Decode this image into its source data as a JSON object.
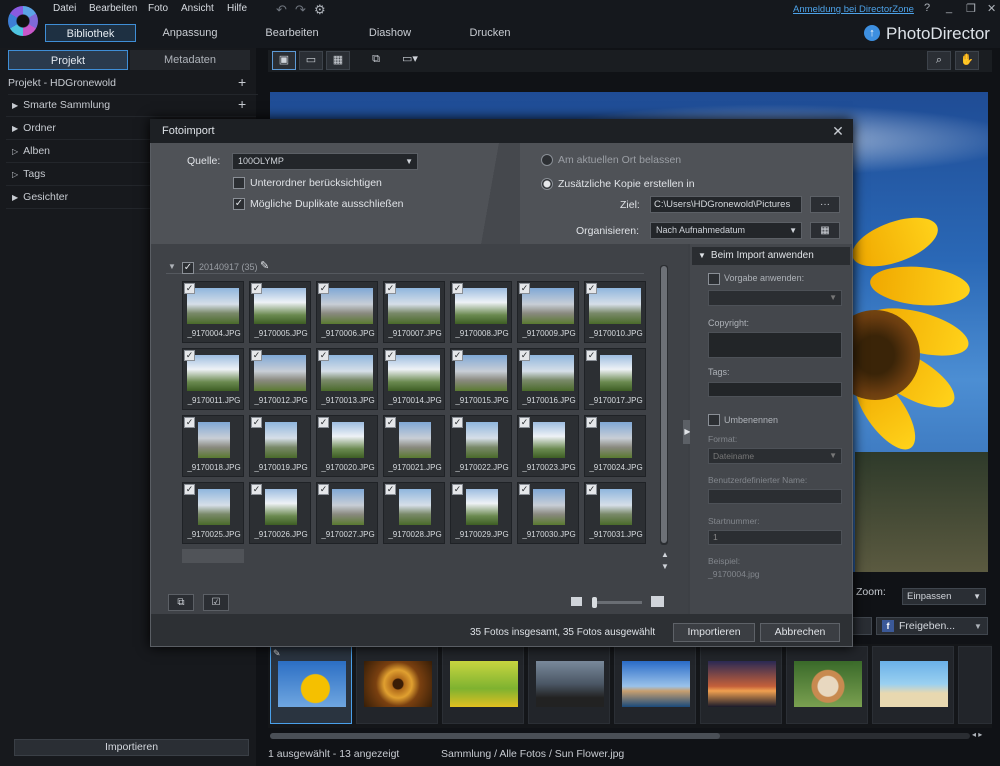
{
  "menu": [
    "Datei",
    "Bearbeiten",
    "Foto",
    "Ansicht",
    "Hilfe"
  ],
  "signin": "Anmeldung bei DirectorZone",
  "window_buttons": [
    "?",
    "_",
    "❐",
    "✕"
  ],
  "modes": [
    "Bibliothek",
    "Anpassung",
    "Bearbeiten",
    "Diashow",
    "Drucken"
  ],
  "brand": "PhotoDirector",
  "left": {
    "tabs": [
      "Projekt",
      "Metadaten"
    ],
    "project": "Projekt - HDGronewold",
    "items": [
      "Smarte Sammlung",
      "Ordner",
      "Alben",
      "Tags",
      "Gesichter"
    ],
    "import_button": "Importieren"
  },
  "view": {
    "zoom_label": "Zoom:",
    "zoom_value": "Einpassen",
    "share_label": "Freigeben..."
  },
  "status": {
    "left": "1 ausgewählt - 13 angezeigt",
    "path": "Sammlung / Alle Fotos / Sun Flower.jpg"
  },
  "dialog": {
    "title": "Fotoimport",
    "source_label": "Quelle:",
    "source_value": "100OLYMP",
    "subfolders": "Unterordner berücksichtigen",
    "duplicates": "Mögliche Duplikate ausschließen",
    "keep_location": "Am aktuellen Ort belassen",
    "copy_to": "Zusätzliche Kopie erstellen in",
    "target_label": "Ziel:",
    "target_value": "C:\\Users\\HDGronewold\\Pictures",
    "browse": "···",
    "organize_label": "Organisieren:",
    "organize_value": "Nach Aufnahmedatum",
    "group": "20140917 (35)",
    "files": [
      "_9170004.JPG",
      "_9170005.JPG",
      "_9170006.JPG",
      "_9170007.JPG",
      "_9170008.JPG",
      "_9170009.JPG",
      "_9170010.JPG",
      "_9170011.JPG",
      "_9170012.JPG",
      "_9170013.JPG",
      "_9170014.JPG",
      "_9170015.JPG",
      "_9170016.JPG",
      "_9170017.JPG",
      "_9170018.JPG",
      "_9170019.JPG",
      "_9170020.JPG",
      "_9170021.JPG",
      "_9170022.JPG",
      "_9170023.JPG",
      "_9170024.JPG",
      "_9170025.JPG",
      "_9170026.JPG",
      "_9170027.JPG",
      "_9170028.JPG",
      "_9170029.JPG",
      "_9170030.JPG",
      "_9170031.JPG"
    ],
    "settings": {
      "header": "Beim Import anwenden",
      "preset": "Vorgabe anwenden:",
      "copyright": "Copyright:",
      "tags": "Tags:",
      "rename": "Umbenennen",
      "format": "Format:",
      "format_value": "Dateiname",
      "custom_name": "Benutzerdefinierter Name:",
      "start_number": "Startnummer:",
      "start_value": "1",
      "example": "Beispiel:",
      "example_value": "_9170004.jpg"
    },
    "summary": "35 Fotos insgesamt, 35 Fotos ausgewählt",
    "import_btn": "Importieren",
    "cancel_btn": "Abbrechen"
  }
}
